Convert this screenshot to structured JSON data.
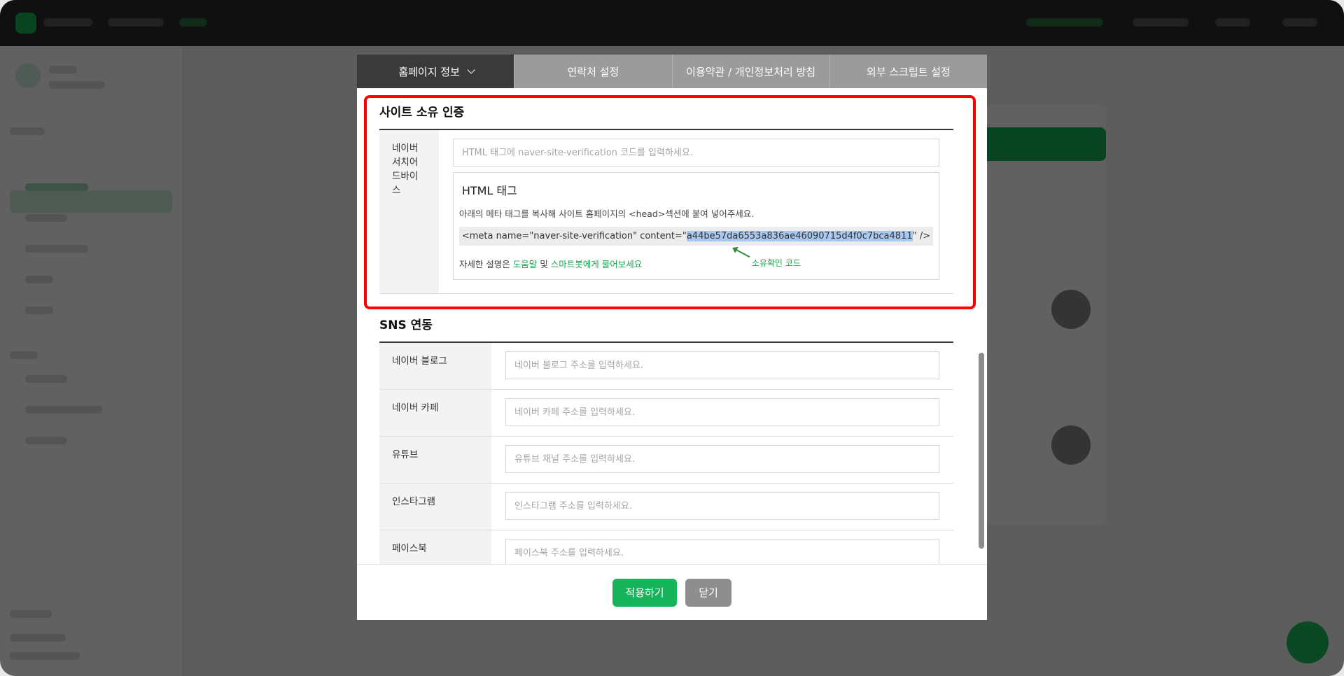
{
  "tabs": [
    {
      "label": "홈페이지 정보",
      "active": true
    },
    {
      "label": "연락처 설정",
      "active": false
    },
    {
      "label": "이용약관 / 개인정보처리 방침",
      "active": false
    },
    {
      "label": "외부 스크립트 설정",
      "active": false
    }
  ],
  "ownership": {
    "title": "사이트 소유 인증",
    "naver_label": "네이버 서치어드바이스",
    "naver_placeholder": "HTML 태그에 naver-site-verification 코드를 입력하세요.",
    "box_title": "HTML 태그",
    "box_desc": "아래의 메타 태그를 복사해 사이트 홈페이지의 <head>섹션에 붙여 넣어주세요.",
    "meta_prefix": "<meta name=\"naver-site-verification\" content=\"",
    "meta_code": "a44be57da6553a836ae46090715d4f0c7bca4811",
    "meta_suffix": "\" />",
    "annotation": "소유확인 코드",
    "help_prefix": "자세한 설명은 ",
    "help_link1": "도움말",
    "help_mid": " 및 ",
    "help_link2": "스마트봇에게 물어보세요"
  },
  "sns": {
    "title": "SNS 연동",
    "rows": [
      {
        "label": "네이버 블로그",
        "placeholder": "네이버 블로그 주소를 입력하세요."
      },
      {
        "label": "네이버 카페",
        "placeholder": "네이버 카페 주소를 입력하세요."
      },
      {
        "label": "유튜브",
        "placeholder": "유튜브 채널 주소를 입력하세요."
      },
      {
        "label": "인스타그램",
        "placeholder": "인스타그램 주소를 입력하세요."
      },
      {
        "label": "페이스북",
        "placeholder": "페이스북 주소를 입력하세요."
      }
    ]
  },
  "footer": {
    "apply_label": "적용하기",
    "close_label": "닫기"
  },
  "colors": {
    "accent": "#16b45a",
    "highlight": "#ff0000",
    "tab_active": "#3a3a3a",
    "tab_inactive": "#9b9b9b"
  }
}
